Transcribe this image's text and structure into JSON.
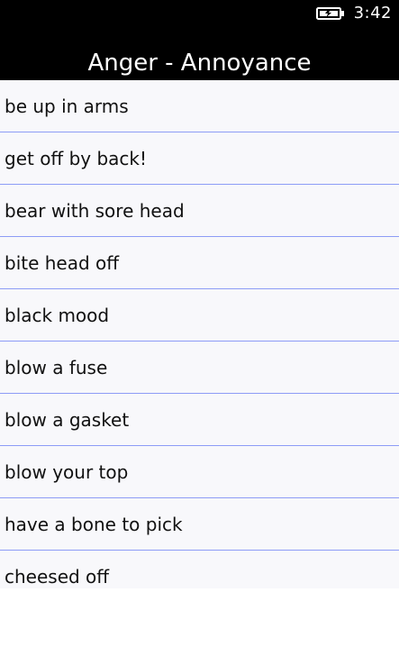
{
  "status_bar": {
    "time": "3:42",
    "battery_icon": "battery-charging-icon"
  },
  "header": {
    "title": "Anger - Annoyance"
  },
  "list": {
    "items": [
      {
        "label": "be up in arms"
      },
      {
        "label": "get off by back!"
      },
      {
        "label": "bear with sore head"
      },
      {
        "label": "bite head off"
      },
      {
        "label": "black mood"
      },
      {
        "label": "blow a fuse"
      },
      {
        "label": "blow a gasket"
      },
      {
        "label": "blow your top"
      },
      {
        "label": "have a bone to pick"
      },
      {
        "label": "cheesed off"
      }
    ]
  },
  "colors": {
    "header_bg": "#000000",
    "list_bg": "#f8f8fb",
    "divider": "#8d9cf6",
    "text": "#111111"
  }
}
